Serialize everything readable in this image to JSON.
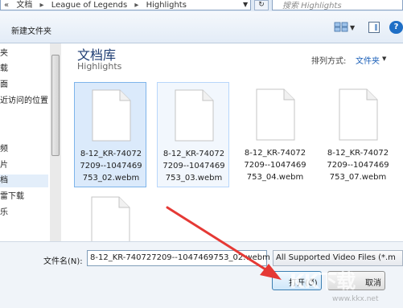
{
  "address": {
    "crumbs": [
      "«",
      "文档",
      "League of Legends",
      "Highlights"
    ],
    "separator": "▸"
  },
  "search": {
    "placeholder": "搜索 Highlights"
  },
  "toolbar": {
    "new_folder": "新建文件夹",
    "help": "?"
  },
  "sidebar": {
    "items": [
      "夹",
      "载",
      "面",
      "近访问的位置",
      "频",
      "片",
      "档",
      "雷下载",
      "乐"
    ],
    "selected_index": 6
  },
  "library": {
    "title": "文档库",
    "subtitle": "Highlights",
    "sort_label": "排列方式:",
    "sort_value": "文件夹"
  },
  "files": [
    {
      "name_lines": [
        "8-12_KR-74072",
        "7209--1047469",
        "753_02.webm"
      ],
      "state": "selected"
    },
    {
      "name_lines": [
        "8-12_KR-74072",
        "7209--1047469",
        "753_03.webm"
      ],
      "state": "hover"
    },
    {
      "name_lines": [
        "8-12_KR-74072",
        "7209--1047469",
        "753_04.webm"
      ],
      "state": "normal"
    },
    {
      "name_lines": [
        "8-12_KR-74072",
        "7209--1047469",
        "753_07.webm"
      ],
      "state": "normal"
    },
    {
      "name_lines": [],
      "state": "normal"
    }
  ],
  "bottom": {
    "filename_label": "文件名(N):",
    "filename_value": "8-12_KR-740727209--1047469753_02.webm",
    "filetype_value": "All Supported Video Files (*.m",
    "open_label": "打开(O)",
    "cancel_label": "取消"
  },
  "colors": {
    "annotation_arrow": "#e53935",
    "selection": "#dbeafb",
    "title_blue": "#1f3d73"
  },
  "watermark": {
    "text": "KK下载",
    "url": "www.kkx.net"
  }
}
